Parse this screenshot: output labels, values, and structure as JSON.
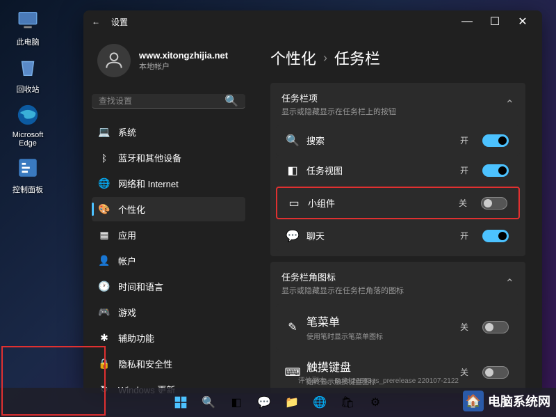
{
  "desktop_icons": [
    {
      "name": "pc",
      "label": "此电脑"
    },
    {
      "name": "recycle",
      "label": "回收站"
    },
    {
      "name": "edge",
      "label": "Microsoft Edge"
    },
    {
      "name": "control",
      "label": "控制面板"
    }
  ],
  "window": {
    "title": "设置",
    "account": {
      "name": "www.xitongzhijia.net",
      "type": "本地帐户"
    },
    "search_placeholder": "查找设置",
    "nav": [
      {
        "id": "system",
        "label": "系统",
        "icon": "💻"
      },
      {
        "id": "bluetooth",
        "label": "蓝牙和其他设备",
        "icon": "ᛒ"
      },
      {
        "id": "network",
        "label": "网络和 Internet",
        "icon": "🌐"
      },
      {
        "id": "personalization",
        "label": "个性化",
        "icon": "🎨"
      },
      {
        "id": "apps",
        "label": "应用",
        "icon": "▦"
      },
      {
        "id": "accounts",
        "label": "帐户",
        "icon": "👤"
      },
      {
        "id": "time",
        "label": "时间和语言",
        "icon": "🕐"
      },
      {
        "id": "gaming",
        "label": "游戏",
        "icon": "🎮"
      },
      {
        "id": "accessibility",
        "label": "辅助功能",
        "icon": "✱"
      },
      {
        "id": "privacy",
        "label": "隐私和安全性",
        "icon": "🔒"
      },
      {
        "id": "update",
        "label": "Windows 更新",
        "icon": "↻"
      }
    ]
  },
  "main": {
    "breadcrumb": [
      "个性化",
      "任务栏"
    ],
    "section1": {
      "title": "任务栏项",
      "subtitle": "显示或隐藏显示在任务栏上的按钮",
      "items": [
        {
          "id": "search",
          "icon": "🔍",
          "label": "搜索",
          "state": "开",
          "on": true
        },
        {
          "id": "taskview",
          "icon": "◧",
          "label": "任务视图",
          "state": "开",
          "on": true
        },
        {
          "id": "widgets",
          "icon": "▭",
          "label": "小组件",
          "state": "关",
          "on": false,
          "highlighted": true
        },
        {
          "id": "chat",
          "icon": "💬",
          "label": "聊天",
          "state": "开",
          "on": true
        }
      ]
    },
    "section2": {
      "title": "任务栏角图标",
      "subtitle": "显示或隐藏显示在任务栏角落的图标",
      "items": [
        {
          "id": "pen",
          "icon": "✎",
          "label": "笔菜单",
          "desc": "使用笔时显示笔菜单图标",
          "state": "关",
          "on": false
        },
        {
          "id": "touchkb",
          "icon": "⌨",
          "label": "触摸键盘",
          "desc": "始终显示触摸键盘图标",
          "state": "关",
          "on": false
        }
      ]
    }
  },
  "build_info": "评估副本。 Build 22533.rs_prerelease 220107-2122",
  "watermark": "电脑系统网"
}
